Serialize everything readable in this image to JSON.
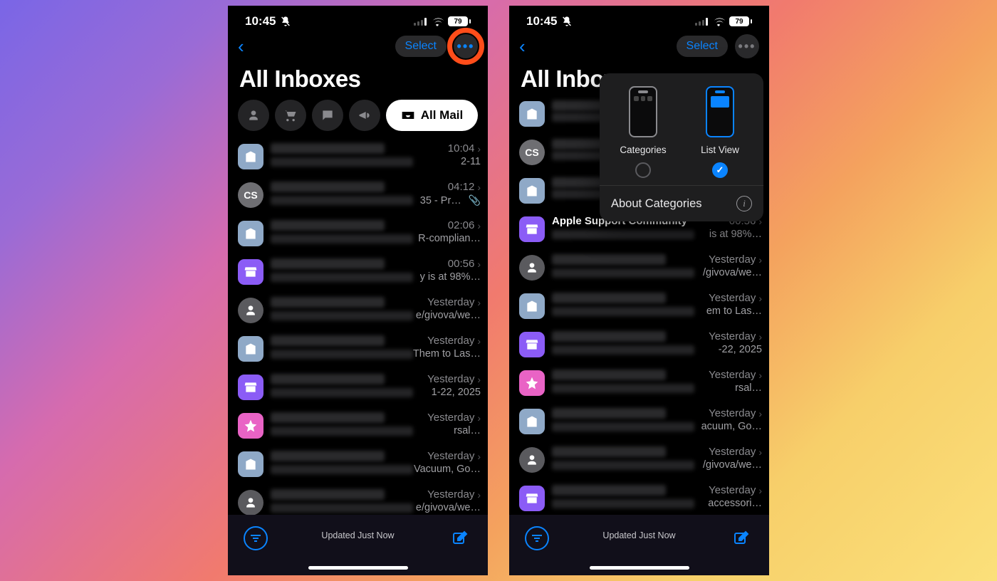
{
  "statusbar": {
    "time": "10:45",
    "battery": "79"
  },
  "nav": {
    "select": "Select"
  },
  "title": "All Inboxes",
  "allmail_label": "All Mail",
  "bottom": {
    "status": "Updated Just Now"
  },
  "popover": {
    "opt_categories": "Categories",
    "opt_listview": "List View",
    "about": "About Categories"
  },
  "rows1": [
    {
      "a": "av-blue",
      "ico": "building",
      "t": "10:04",
      "s": "2-11",
      "clip": false
    },
    {
      "a": "av-grey",
      "ico": "text",
      "txt": "CS",
      "t": "04:12",
      "s": "35 - Pr…",
      "clip": true
    },
    {
      "a": "av-blue",
      "ico": "building",
      "t": "02:06",
      "s": "R-complian…",
      "clip": false
    },
    {
      "a": "av-store",
      "ico": "store",
      "t": "00:56",
      "s": "y is at 98%…",
      "clip": false
    },
    {
      "a": "av-person",
      "ico": "person",
      "t": "Yesterday",
      "s": "e/givova/we…",
      "clip": false
    },
    {
      "a": "av-blue",
      "ico": "building",
      "t": "Yesterday",
      "s": "Them to Las…",
      "clip": false
    },
    {
      "a": "av-store",
      "ico": "store",
      "t": "Yesterday",
      "s": "1-22, 2025",
      "clip": false
    },
    {
      "a": "av-star",
      "ico": "star",
      "t": "Yesterday",
      "s": "rsal…",
      "clip": false
    },
    {
      "a": "av-blue",
      "ico": "building",
      "t": "Yesterday",
      "s": "Vacuum, Go…",
      "clip": false
    },
    {
      "a": "av-person",
      "ico": "person",
      "t": "Yesterday",
      "s": "e/givova/we…",
      "clip": false
    }
  ],
  "rows2": [
    {
      "a": "av-blue",
      "ico": "building",
      "t": "",
      "s": "",
      "clip": false
    },
    {
      "a": "av-grey",
      "ico": "text",
      "txt": "CS",
      "t": "",
      "s": "",
      "clip": false
    },
    {
      "a": "av-blue",
      "ico": "building",
      "t": "",
      "s": "",
      "clip": false
    },
    {
      "a": "av-store",
      "ico": "store",
      "t": "00:56",
      "s": "is at 98%…",
      "clip": false
    },
    {
      "a": "av-person",
      "ico": "person",
      "t": "Yesterday",
      "s": "/givova/we…",
      "clip": false
    },
    {
      "a": "av-blue",
      "ico": "building",
      "t": "Yesterday",
      "s": "em to Las…",
      "clip": false
    },
    {
      "a": "av-store",
      "ico": "store",
      "t": "Yesterday",
      "s": "-22, 2025",
      "clip": false
    },
    {
      "a": "av-star",
      "ico": "star",
      "t": "Yesterday",
      "s": "rsal…",
      "clip": false
    },
    {
      "a": "av-blue",
      "ico": "building",
      "t": "Yesterday",
      "s": "acuum, Go…",
      "clip": false
    },
    {
      "a": "av-person",
      "ico": "person",
      "t": "Yesterday",
      "s": "/givova/we…",
      "clip": false
    },
    {
      "a": "av-store",
      "ico": "store",
      "t": "Yesterday",
      "s": "accessori…",
      "clip": false
    }
  ],
  "row2_extra_sender": "Apple Support Community"
}
